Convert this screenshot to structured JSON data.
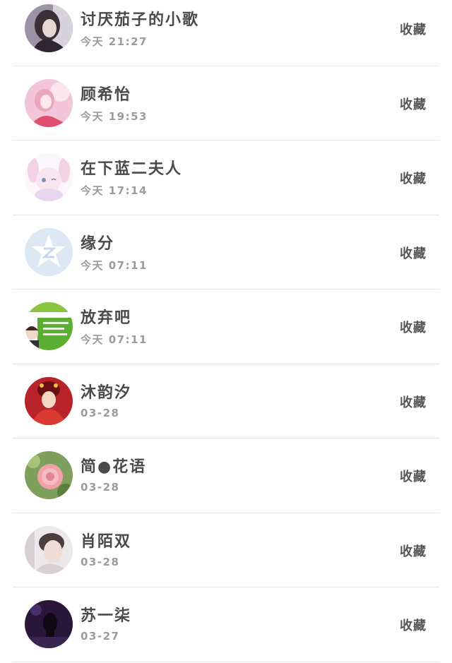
{
  "contacts": [
    {
      "name": "讨厌茄子的小歌",
      "time": "今天 21:27",
      "action": "收藏",
      "avatar": "avatar-dark-hair-girl"
    },
    {
      "name": "顾希怡",
      "time": "今天 19:53",
      "action": "收藏",
      "avatar": "avatar-pink-girl"
    },
    {
      "name": "在下蓝二夫人",
      "time": "今天 17:14",
      "action": "收藏",
      "avatar": "avatar-anime-bunny"
    },
    {
      "name": "缘分",
      "time": "今天 07:11",
      "action": "收藏",
      "avatar": "avatar-default-qq"
    },
    {
      "name": "放弃吧",
      "time": "今天 07:11",
      "action": "收藏",
      "avatar": "avatar-green-poster"
    },
    {
      "name": "沐韵汐",
      "time": "03-28",
      "action": "收藏",
      "avatar": "avatar-red-costume"
    },
    {
      "name": "简●花语",
      "time": "03-28",
      "action": "收藏",
      "avatar": "avatar-pink-flower"
    },
    {
      "name": "肖陌双",
      "time": "03-28",
      "action": "收藏",
      "avatar": "avatar-young-man"
    },
    {
      "name": "苏一柒",
      "time": "03-27",
      "action": "收藏",
      "avatar": "avatar-dark-purple"
    }
  ]
}
